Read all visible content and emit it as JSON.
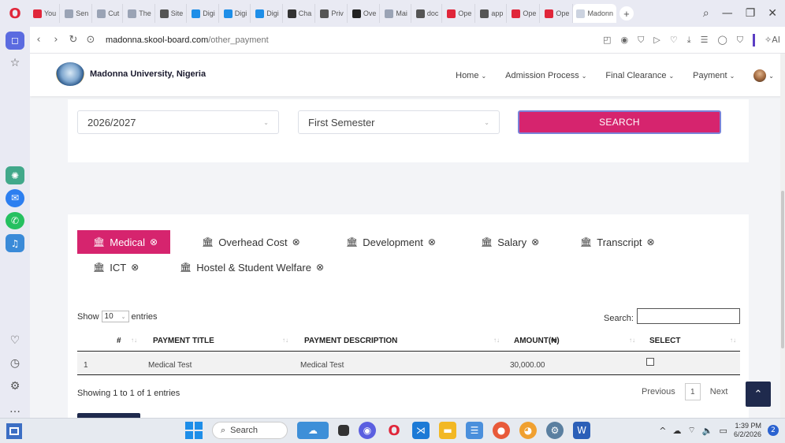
{
  "browser": {
    "tabs": [
      {
        "label": "You",
        "color": "#e0263a"
      },
      {
        "label": "Sen",
        "color": "#9aa3b5"
      },
      {
        "label": "Cut",
        "color": "#9aa3b5"
      },
      {
        "label": "The",
        "color": "#9aa3b5"
      },
      {
        "label": "Site",
        "color": "#555"
      },
      {
        "label": "Digi",
        "color": "#1e8ee8"
      },
      {
        "label": "Digi",
        "color": "#1e8ee8"
      },
      {
        "label": "Digi",
        "color": "#1e8ee8"
      },
      {
        "label": "Cha",
        "color": "#333"
      },
      {
        "label": "Priv",
        "color": "#555"
      },
      {
        "label": "Ove",
        "color": "#222"
      },
      {
        "label": "Mai",
        "color": "#9aa3b5"
      },
      {
        "label": "doc",
        "color": "#555"
      },
      {
        "label": "Ope",
        "color": "#e0263a"
      },
      {
        "label": "app",
        "color": "#555"
      },
      {
        "label": "Ope",
        "color": "#e0263a"
      },
      {
        "label": "Ope",
        "color": "#e0263a"
      }
    ],
    "active_tab": "Madonn",
    "new_tab": "+",
    "url_domain": "madonna.skool-board.com",
    "url_path": "/other_payment",
    "ai_label": "AI"
  },
  "site": {
    "name": "Madonna University, Nigeria",
    "menu": [
      "Home",
      "Admission Process",
      "Final Clearance",
      "Payment"
    ]
  },
  "filters": {
    "session": "2026/2027",
    "semester": "First Semester",
    "search_label": "SEARCH"
  },
  "payment_tabs": [
    "Medical",
    "Overhead Cost",
    "Development",
    "Salary",
    "Transcript",
    "ICT",
    "Hostel & Student Welfare"
  ],
  "table": {
    "show": "Show",
    "length": "10",
    "entries": "entries",
    "search": "Search:",
    "headers": [
      "#",
      "PAYMENT TITLE",
      "PAYMENT DESCRIPTION",
      "AMOUNT(₦)",
      "SELECT"
    ],
    "rows": [
      {
        "num": "1",
        "title": "Medical Test",
        "description": "Medical Test",
        "amount": "30,000.00"
      }
    ],
    "info": "Showing 1 to 1 of 1 entries",
    "previous": "Previous",
    "page": "1",
    "next": "Next"
  },
  "taskbar": {
    "search": "Search",
    "time": "1:39 PM",
    "date": "6/2/2026",
    "badge": "2"
  },
  "colors": {
    "accent": "#d6246e",
    "navy": "#1f2a4d"
  }
}
